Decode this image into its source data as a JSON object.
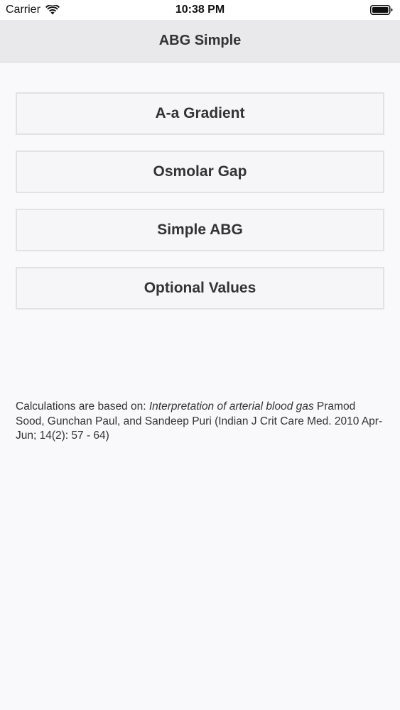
{
  "status_bar": {
    "carrier": "Carrier",
    "time": "10:38 PM",
    "icons": [
      "wifi-icon",
      "battery-icon"
    ]
  },
  "nav": {
    "title": "ABG Simple"
  },
  "menu": {
    "items": [
      {
        "label": "A-a Gradient"
      },
      {
        "label": "Osmolar Gap"
      },
      {
        "label": "Simple ABG"
      },
      {
        "label": "Optional Values"
      }
    ]
  },
  "citation": {
    "prefix": "Calculations are based on: ",
    "title": "Interpretation of arterial blood gas",
    "suffix": " Pramod Sood, Gunchan Paul, and Sandeep Puri (Indian J Crit Care Med. 2010 Apr-Jun; 14(2): 57 - 64)"
  },
  "colors": {
    "background": "#f9f8fa",
    "nav_background": "#e9e8ea",
    "button_background": "#f6f5f7",
    "button_border": "#e2e1e3",
    "text": "#333333"
  }
}
